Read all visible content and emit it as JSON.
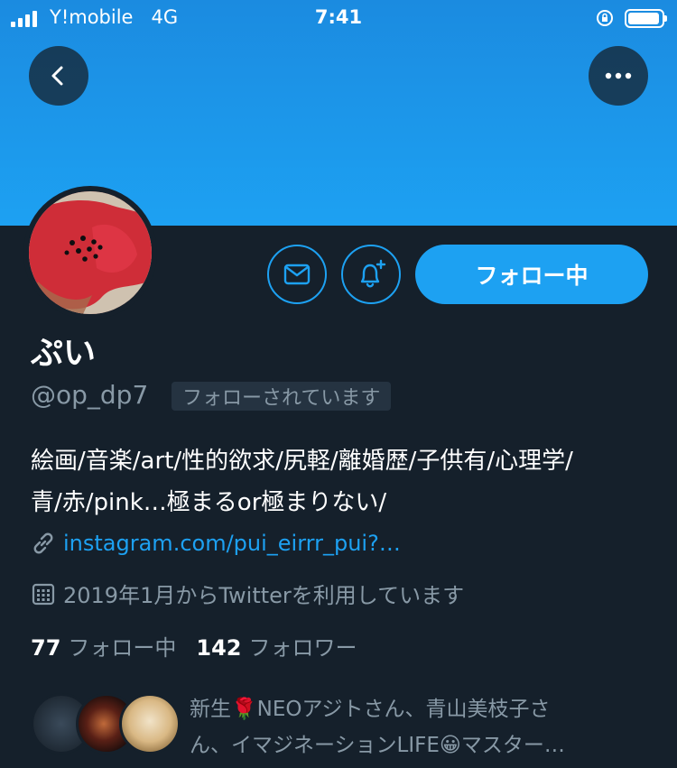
{
  "status_bar": {
    "carrier": "Y!mobile",
    "network": "4G",
    "time": "7:41"
  },
  "profile": {
    "display_name": "ぷい",
    "handle": "@op_dp7",
    "follows_you": "フォローされています",
    "bio_line1": "絵画/音楽/art/性的欲求/尻軽/離婚歴/子供有/心理学/",
    "bio_line2": "青/赤/pink…極まるor極まりない/",
    "link": "instagram.com/pui_eirrr_pui?…",
    "joined": "2019年1月からTwitterを利用しています"
  },
  "actions": {
    "follow_label": "フォロー中"
  },
  "stats": {
    "following_count": "77",
    "following_label": "フォロー中",
    "followers_count": "142",
    "followers_label": "フォロワー"
  },
  "followed_by": {
    "line1": "新生🌹NEOアジトさん、青山美枝子さ",
    "line2": "ん、イマジネーションLIFE😀マスター…"
  },
  "icons": {
    "back": "chevron-left-icon",
    "more": "more-horizontal-icon",
    "message": "envelope-icon",
    "notify": "bell-plus-icon",
    "link": "link-icon",
    "calendar": "calendar-icon",
    "orientation_lock": "orientation-lock-icon",
    "battery": "battery-icon"
  },
  "colors": {
    "background": "#15202b",
    "accent": "#1da1f2",
    "secondary_text": "#8899a6"
  }
}
